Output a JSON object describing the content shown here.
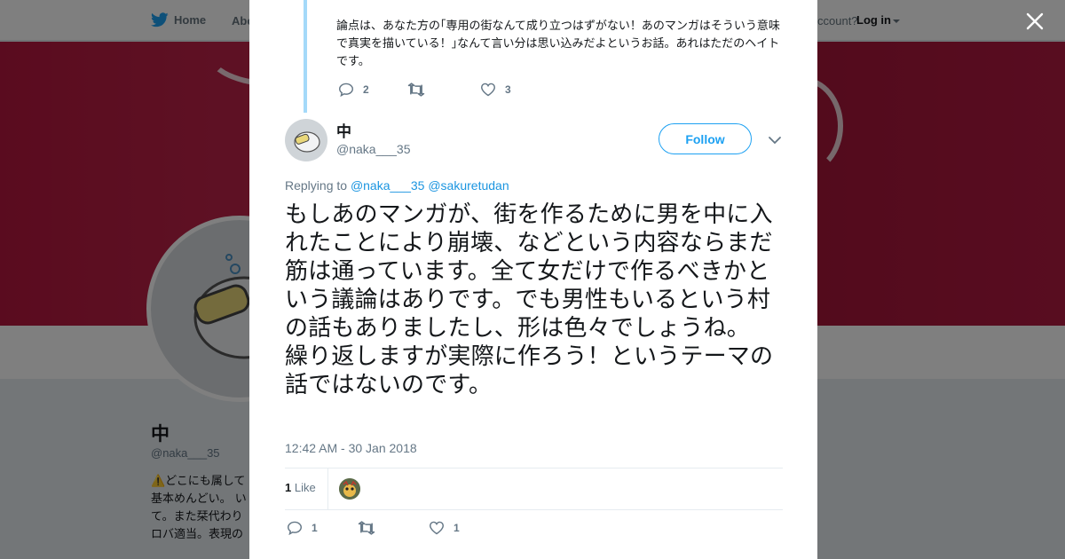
{
  "background": {
    "nav": {
      "home_label": "Home",
      "about_label": "Abo",
      "account_text": "ccount?",
      "login_label": "Log in"
    },
    "profile": {
      "name": "中",
      "handle": "@naka___35",
      "bio": "⚠️どこにも属して\n基本めんどい。 い\nて。また栞代わり\nロバ適当。表現の"
    }
  },
  "modal": {
    "parent_tweet": {
      "text": "論点は、あなた方の｢専用の街なんて成り立つはずがない！あのマンガはそういう意味で真実を描いている！｣なんて言い分は思い込みだよというお話。あれはただのヘイトです。",
      "reply_count": "2",
      "retweet_count": "",
      "like_count": "3"
    },
    "tweet": {
      "author_name": "中",
      "author_handle": "@naka___35",
      "follow_label": "Follow",
      "replying_prefix": "Replying to",
      "replying_to_1": "@naka___35",
      "replying_to_2": "@sakuretudan",
      "text": "もしあのマンガが、街を作るために男を中に入れたことにより崩壊、などという内容ならまだ筋は通っています。全て女だけで作るべきかという議論はありです。でも男性もいるという村の話もありましたし、形は色々でしょうね。\n繰り返しますが実際に作ろう！というテーマの話ではないのです。",
      "timestamp": "12:42 AM - 30 Jan 2018",
      "likes_count": "1",
      "likes_label": "Like",
      "reply_count": "1",
      "retweet_count": "",
      "like_count": "1"
    }
  },
  "colors": {
    "accent": "#1da1f2",
    "link": "#1b95e0",
    "muted_text": "#657786",
    "thread_line": "#a4d9f9",
    "banner": "#b5173e"
  },
  "icons": [
    "twitter-bird-icon",
    "close-icon",
    "reply-icon",
    "retweet-icon",
    "heart-icon",
    "chevron-down-icon"
  ]
}
